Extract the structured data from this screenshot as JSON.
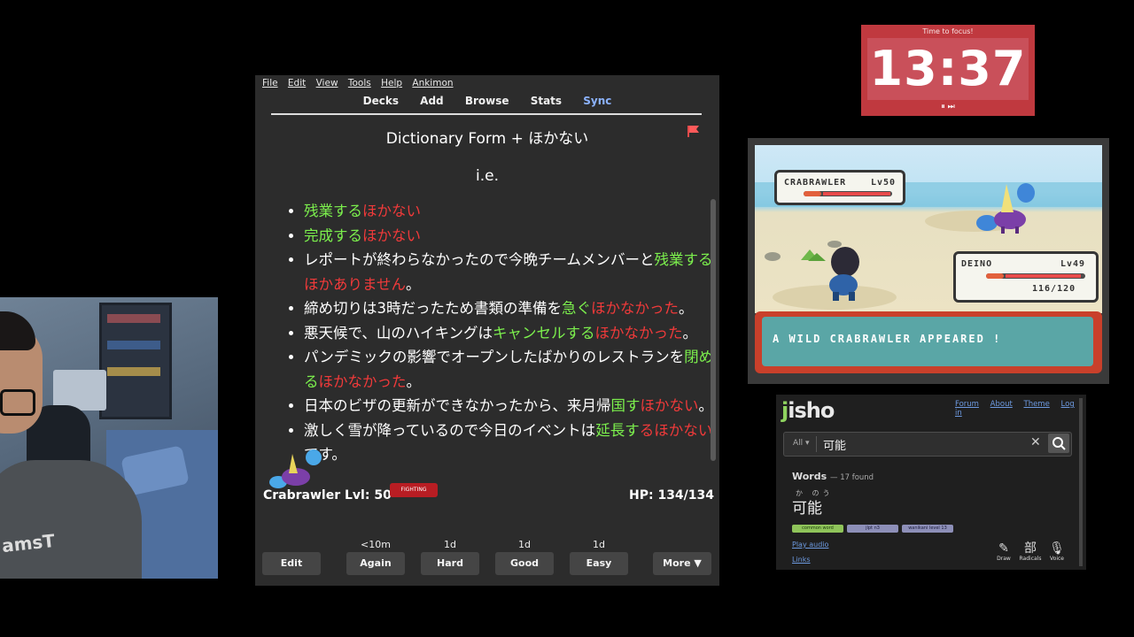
{
  "anki": {
    "menu": [
      "File",
      "Edit",
      "View",
      "Tools",
      "Help",
      "Ankimon"
    ],
    "toolbar": {
      "decks": "Decks",
      "add": "Add",
      "browse": "Browse",
      "stats": "Stats",
      "sync": "Sync"
    },
    "card_title": "Dictionary Form + ほかない",
    "ie": "i.e.",
    "examples": [
      [
        {
          "t": "残業する",
          "c": "g"
        },
        {
          "t": "ほかない",
          "c": "r"
        }
      ],
      [
        {
          "t": "完成する",
          "c": "g"
        },
        {
          "t": "ほかない",
          "c": "r"
        }
      ],
      [
        {
          "t": "レポートが終わらなかったので今晩チームメンバーと",
          "c": ""
        },
        {
          "t": "残業する",
          "c": "g"
        },
        {
          "t": "ほかありません",
          "c": "r"
        },
        {
          "t": "。",
          "c": ""
        }
      ],
      [
        {
          "t": "締め切りは3時だったため書類の準備を",
          "c": ""
        },
        {
          "t": "急ぐ",
          "c": "g"
        },
        {
          "t": "ほかなかった",
          "c": "r"
        },
        {
          "t": "。",
          "c": ""
        }
      ],
      [
        {
          "t": "悪天候で、山のハイキングは",
          "c": ""
        },
        {
          "t": "キャンセルする",
          "c": "g"
        },
        {
          "t": "ほかなかった",
          "c": "r"
        },
        {
          "t": "。",
          "c": ""
        }
      ],
      [
        {
          "t": "パンデミックの影響でオープンしたばかりのレストランを",
          "c": ""
        },
        {
          "t": "閉める",
          "c": "g"
        },
        {
          "t": "ほかなかった",
          "c": "r"
        },
        {
          "t": "。",
          "c": ""
        }
      ],
      [
        {
          "t": "日本のビザの更新ができなかったから、来月帰",
          "c": ""
        },
        {
          "t": "国す",
          "c": "g"
        },
        {
          "t": "ほかない",
          "c": "r"
        },
        {
          "t": "。",
          "c": ""
        }
      ],
      [
        {
          "t": "激しく雪が降っているので今日のイベントは",
          "c": ""
        },
        {
          "t": "延長す",
          "c": "g"
        },
        {
          "t": "るほかない",
          "c": "r"
        },
        {
          "t": "です。",
          "c": ""
        }
      ]
    ],
    "ankimon": {
      "name": "Crabrawler Lvl: 50",
      "hp": "HP: 134/134",
      "type": "FIGHTING"
    },
    "answer": {
      "edit": "Edit",
      "again_ivl": "<10m",
      "again": "Again",
      "hard_ivl": "1d",
      "hard": "Hard",
      "good_ivl": "1d",
      "good": "Good",
      "easy_ivl": "1d",
      "easy": "Easy",
      "more": "More ▼"
    }
  },
  "timer": {
    "label": "Time to focus!",
    "time": "13:37",
    "controls": "⏸ ⏭"
  },
  "game": {
    "enemy_name": "CRABRAWLER",
    "enemy_level": "Lv50",
    "enemy_hp_fraction": 1.0,
    "player_name": "DEINO",
    "player_level": "Lv49",
    "player_hp": "116/120",
    "player_hp_fraction": 0.97,
    "message": "A WILD CRABRAWLER APPEARED !"
  },
  "jisho": {
    "logo_j": "j",
    "logo_rest": "isho",
    "nav": [
      "Forum",
      "About",
      "Theme",
      "Log in"
    ],
    "search_scope": "All ▾",
    "query": "可能",
    "words_label": "Words",
    "words_count": "— 17 found",
    "furigana": "か のう",
    "word": "可能",
    "tags": [
      "common word",
      "jlpt n3",
      "wanikani level 13"
    ],
    "play_audio": "Play audio",
    "links": "Links",
    "tools": [
      {
        "glyph": "✎",
        "label": "Draw"
      },
      {
        "glyph": "部",
        "label": "Radicals"
      },
      {
        "glyph": "🎙",
        "label": "Voice"
      }
    ]
  },
  "webcam": {
    "shirt_text": "amsT"
  }
}
